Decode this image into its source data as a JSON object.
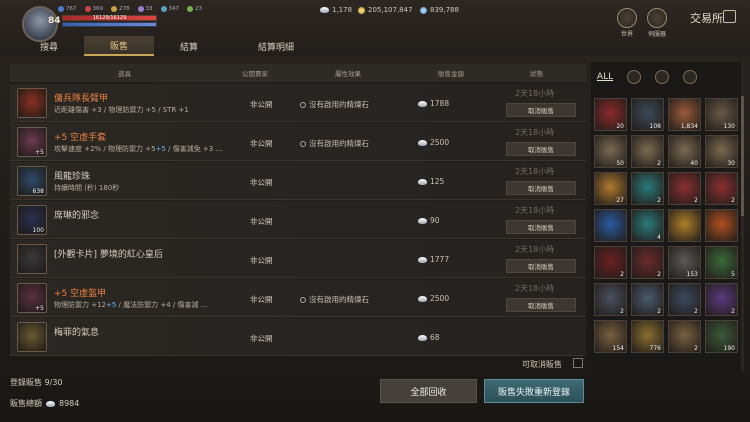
{
  "header": {
    "level": "84",
    "stats": [
      "767",
      "369",
      "278",
      "33",
      "347",
      "23"
    ],
    "hp_text": "16129/16129",
    "currency": [
      "1,178",
      "205,107,847",
      "839,788"
    ],
    "tabs": [
      "搜尋",
      "販售",
      "結算",
      "結算明細"
    ],
    "world_label": "世界",
    "server_label": "伺服器",
    "title": "交易所"
  },
  "table": {
    "columns": [
      "道具",
      "公開賣家",
      "屬性效果",
      "販售金額",
      "狀態"
    ],
    "rows": [
      {
        "name": "傭兵隊長臂甲",
        "desc": "近距離傷害 +3 / 物理防禦力 +5 / STR +1",
        "pub": "非公開",
        "effect": "沒有啟用的精煉石",
        "price": "1788",
        "time": "2天18小時",
        "btn": "取消販售",
        "count": "",
        "color": "#8a3020"
      },
      {
        "name": "+5 空虛手套",
        "desc_a": "攻擊速度 +2% / 物理防禦力 +5",
        "desc_b": "+5",
        "desc_c": " / 傷害減免 +3 ...",
        "pub": "非公開",
        "effect": "沒有啟用的精煉石",
        "price": "2500",
        "time": "2天18小時",
        "btn": "取消販售",
        "count": "+5",
        "color": "#6a3a50"
      },
      {
        "name": "風龍珍珠",
        "desc": "持續時間 (秒) 180秒",
        "pub": "非公開",
        "effect": "",
        "price": "125",
        "time": "2天18小時",
        "btn": "取消販售",
        "count": "638",
        "color": "#2d4a6a"
      },
      {
        "name": "席琳的邪念",
        "desc": "",
        "pub": "非公開",
        "effect": "",
        "price": "90",
        "time": "2天18小時",
        "btn": "取消販售",
        "count": "100",
        "color": "#2a3050"
      },
      {
        "name": "[外觀卡片] 夢境的紅心皇后",
        "desc": "",
        "pub": "非公開",
        "effect": "",
        "price": "1777",
        "time": "2天18小時",
        "btn": "取消販售",
        "count": "",
        "color": "#3a3a3a"
      },
      {
        "name": "+5 空虛盔甲",
        "desc_a": "物理防禦力 +12",
        "desc_b": "+5",
        "desc_c": " / 魔法防禦力 +4 / 傷害減 ...",
        "pub": "非公開",
        "effect": "沒有啟用的精煉石",
        "price": "2500",
        "time": "2天18小時",
        "btn": "取消販售",
        "count": "+5",
        "color": "#5a3040"
      },
      {
        "name": "梅菲的氣息",
        "desc": "",
        "pub": "非公開",
        "effect": "",
        "price": "68",
        "time": "",
        "btn": "",
        "count": "",
        "color": "#6a5a30"
      }
    ]
  },
  "footer": {
    "cancelable_label": "可取消販售",
    "registered": "登錄販售 9/30",
    "total_label": "販售總額",
    "total_value": "8984",
    "collect_button": "全部回收",
    "relist_button": "販售失敗重新登錄"
  },
  "inventory": {
    "tab_all": "ALL",
    "slots": [
      {
        "count": "20",
        "color": "#8a2a2a"
      },
      {
        "count": "108",
        "color": "#3d4a5a"
      },
      {
        "count": "1,834",
        "color": "#9a5a3a"
      },
      {
        "count": "130",
        "color": "#6a5a48"
      },
      {
        "count": "50",
        "color": "#7a6a50"
      },
      {
        "count": "2",
        "color": "#7a6a50"
      },
      {
        "count": "40",
        "color": "#7a6a50"
      },
      {
        "count": "30",
        "color": "#7a6a50"
      },
      {
        "count": "27",
        "color": "#b07a30"
      },
      {
        "count": "2",
        "color": "#2a7a7a"
      },
      {
        "count": "2",
        "color": "#8a3030"
      },
      {
        "count": "2",
        "color": "#8a3030"
      },
      {
        "count": "",
        "color": "#2a5aa0"
      },
      {
        "count": "4",
        "color": "#2a7a7a"
      },
      {
        "count": "",
        "color": "#b0802a"
      },
      {
        "count": "",
        "color": "#b05020"
      },
      {
        "count": "2",
        "color": "#6a2020"
      },
      {
        "count": "2",
        "color": "#6a2a2a"
      },
      {
        "count": "153",
        "color": "#5a5a5a"
      },
      {
        "count": "5",
        "color": "#3a6a3a"
      },
      {
        "count": "2",
        "color": "#4a5060"
      },
      {
        "count": "2",
        "color": "#4a5a70"
      },
      {
        "count": "2",
        "color": "#3a4a60"
      },
      {
        "count": "2",
        "color": "#5a3a80"
      },
      {
        "count": "154",
        "color": "#7a6040"
      },
      {
        "count": "776",
        "color": "#8a7030"
      },
      {
        "count": "2",
        "color": "#7a6040"
      },
      {
        "count": "190",
        "color": "#3a5a3a"
      }
    ]
  }
}
